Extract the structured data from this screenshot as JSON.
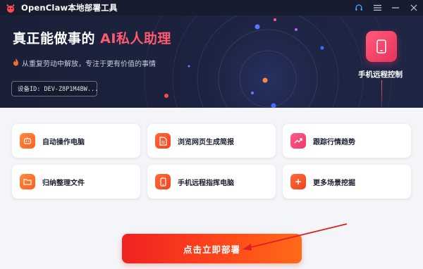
{
  "app": {
    "title": "OpenClaw本地部署工具"
  },
  "hero": {
    "title_prefix": "真正能做事的 ",
    "title_accent": "AI私人助理",
    "subtitle": "从重复劳动中解放，专注于更有价值的事情",
    "device_id": "设备ID: DEV-Z8P1M4BW..."
  },
  "remote": {
    "label": "手机远程控制"
  },
  "features": [
    {
      "label": "自动操作电脑",
      "icon": "robot-icon",
      "color": "orange"
    },
    {
      "label": "浏览网页生成简报",
      "icon": "document-icon",
      "color": "red"
    },
    {
      "label": "跟踪行情趋势",
      "icon": "trend-icon",
      "color": "pink"
    },
    {
      "label": "归纳整理文件",
      "icon": "folder-icon",
      "color": "orange"
    },
    {
      "label": "手机远程指挥电脑",
      "icon": "phone-icon",
      "color": "red"
    },
    {
      "label": "更多场景挖掘",
      "icon": "plus-icon",
      "color": "red"
    }
  ],
  "cta": {
    "label": "点击立即部署"
  },
  "colors": {
    "accent": "#ff5a6e",
    "cta": "#ee2222",
    "titlebar": "#171c2e"
  }
}
